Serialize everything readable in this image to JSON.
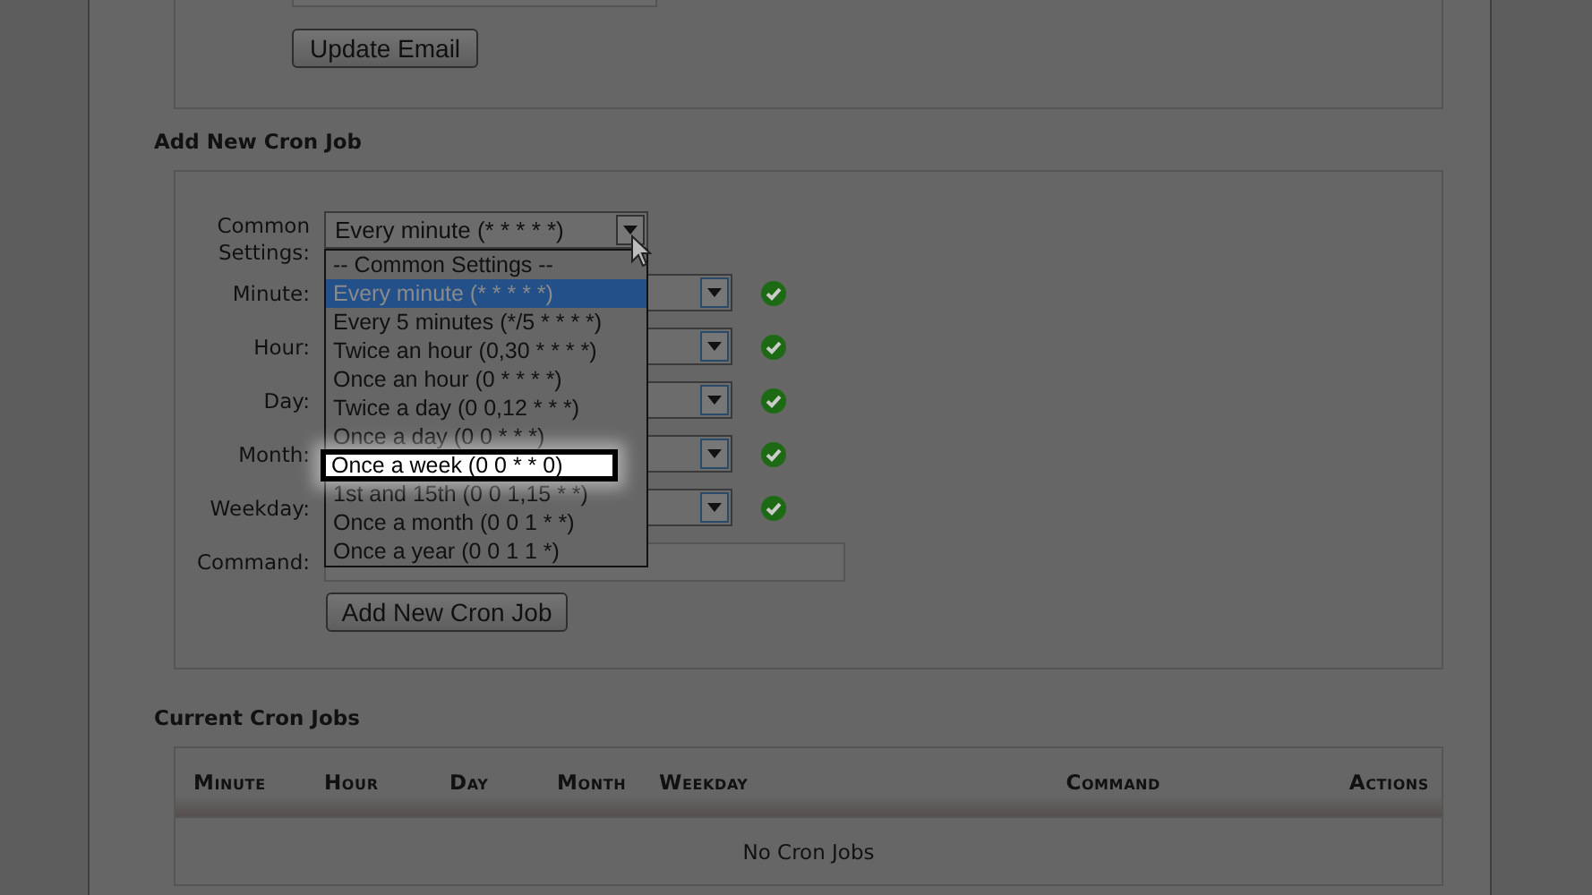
{
  "email_section": {
    "button": "Update Email"
  },
  "add_cron": {
    "title": "Add New Cron Job",
    "common": {
      "label": "Common Settings:",
      "value": "Every minute (* * * * *)",
      "expanded": true,
      "options": [
        {
          "label": "-- Common Settings --",
          "selected": false,
          "highlighted": false
        },
        {
          "label": "Every minute (* * * * *)",
          "selected": true,
          "highlighted": false
        },
        {
          "label": "Every 5 minutes (*/5 * * * *)",
          "selected": false,
          "highlighted": false
        },
        {
          "label": "Twice an hour (0,30 * * * *)",
          "selected": false,
          "highlighted": false
        },
        {
          "label": "Once an hour (0 * * * *)",
          "selected": false,
          "highlighted": false
        },
        {
          "label": "Twice a day (0 0,12 * * *)",
          "selected": false,
          "highlighted": false
        },
        {
          "label": "Once a day (0 0 * * *)",
          "selected": false,
          "highlighted": false
        },
        {
          "label": "Once a week (0 0 * * 0)",
          "selected": false,
          "highlighted": true
        },
        {
          "label": "1st and 15th (0 0 1,15 * *)",
          "selected": false,
          "highlighted": false
        },
        {
          "label": "Once a month (0 0 1 * *)",
          "selected": false,
          "highlighted": false
        },
        {
          "label": "Once a year (0 0 1 1 *)",
          "selected": false,
          "highlighted": false
        }
      ]
    },
    "fields": [
      {
        "label": "Minute:",
        "kind": "select",
        "valid": true
      },
      {
        "label": "Hour:",
        "kind": "select",
        "valid": true
      },
      {
        "label": "Day:",
        "kind": "select",
        "valid": true
      },
      {
        "label": "Month:",
        "kind": "select",
        "valid": true
      },
      {
        "label": "Weekday:",
        "kind": "select",
        "valid": true
      },
      {
        "label": "Command:",
        "kind": "text",
        "valid": false
      }
    ],
    "button": "Add New Cron Job"
  },
  "current_cron": {
    "title": "Current Cron Jobs",
    "columns": [
      "Minute",
      "Hour",
      "Day",
      "Month",
      "Weekday",
      "Command",
      "Actions"
    ],
    "empty_text": "No Cron Jobs"
  }
}
